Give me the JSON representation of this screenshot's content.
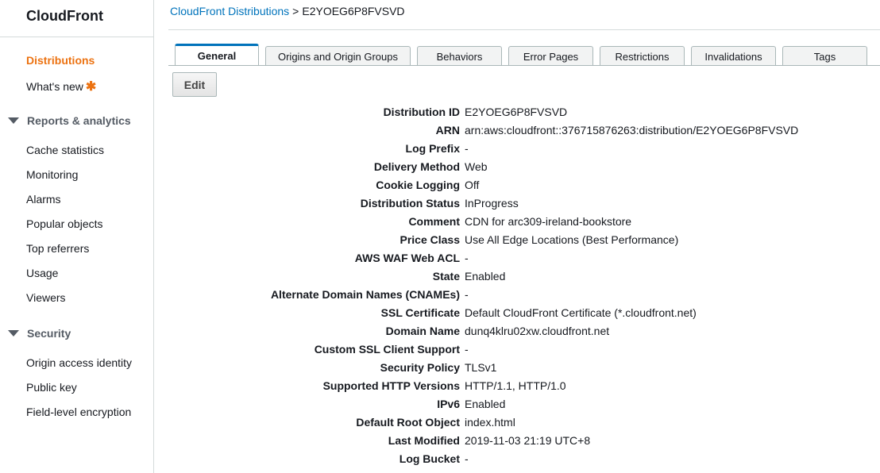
{
  "sidebar": {
    "brand": "CloudFront",
    "items": [
      {
        "label": "Distributions",
        "active": true
      },
      {
        "label": "What's new",
        "badge": "✱"
      }
    ],
    "sections": [
      {
        "title": "Reports & analytics",
        "items": [
          "Cache statistics",
          "Monitoring",
          "Alarms",
          "Popular objects",
          "Top referrers",
          "Usage",
          "Viewers"
        ]
      },
      {
        "title": "Security",
        "items": [
          "Origin access identity",
          "Public key",
          "Field-level encryption"
        ]
      }
    ]
  },
  "breadcrumb": {
    "parent": "CloudFront Distributions",
    "separator": ">",
    "current": "E2YOEG6P8FVSVD"
  },
  "tabs": [
    {
      "label": "General",
      "active": true
    },
    {
      "label": "Origins and Origin Groups"
    },
    {
      "label": "Behaviors"
    },
    {
      "label": "Error Pages"
    },
    {
      "label": "Restrictions"
    },
    {
      "label": "Invalidations"
    },
    {
      "label": "Tags"
    }
  ],
  "edit_button": "Edit",
  "details": [
    {
      "label": "Distribution ID",
      "value": "E2YOEG6P8FVSVD"
    },
    {
      "label": "ARN",
      "value": "arn:aws:cloudfront::376715876263:distribution/E2YOEG6P8FVSVD"
    },
    {
      "label": "Log Prefix",
      "value": "-"
    },
    {
      "label": "Delivery Method",
      "value": "Web"
    },
    {
      "label": "Cookie Logging",
      "value": "Off"
    },
    {
      "label": "Distribution Status",
      "value": "InProgress"
    },
    {
      "label": "Comment",
      "value": "CDN for arc309-ireland-bookstore"
    },
    {
      "label": "Price Class",
      "value": "Use All Edge Locations (Best Performance)"
    },
    {
      "label": "AWS WAF Web ACL",
      "value": "-"
    },
    {
      "label": "State",
      "value": "Enabled"
    },
    {
      "label": "Alternate Domain Names (CNAMEs)",
      "value": "-"
    },
    {
      "label": "SSL Certificate",
      "value": "Default CloudFront Certificate (*.cloudfront.net)"
    },
    {
      "label": "Domain Name",
      "value": "dunq4klru02xw.cloudfront.net"
    },
    {
      "label": "Custom SSL Client Support",
      "value": "-"
    },
    {
      "label": "Security Policy",
      "value": "TLSv1"
    },
    {
      "label": "Supported HTTP Versions",
      "value": "HTTP/1.1, HTTP/1.0"
    },
    {
      "label": "IPv6",
      "value": "Enabled"
    },
    {
      "label": "Default Root Object",
      "value": "index.html"
    },
    {
      "label": "Last Modified",
      "value": "2019-11-03 21:19 UTC+8"
    },
    {
      "label": "Log Bucket",
      "value": "-"
    }
  ],
  "colors": {
    "accent_orange": "#ec7211",
    "link_blue": "#0073bb",
    "border": "#aab7b8"
  }
}
